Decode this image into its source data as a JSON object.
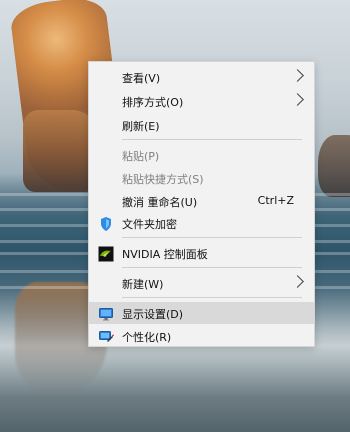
{
  "menu": {
    "items": [
      {
        "label": "查看(V)",
        "has_submenu": true,
        "disabled": false,
        "shortcut": ""
      },
      {
        "label": "排序方式(O)",
        "has_submenu": true,
        "disabled": false,
        "shortcut": ""
      },
      {
        "label": "刷新(E)",
        "has_submenu": false,
        "disabled": false,
        "shortcut": ""
      },
      {
        "label": "粘贴(P)",
        "has_submenu": false,
        "disabled": true,
        "shortcut": ""
      },
      {
        "label": "粘贴快捷方式(S)",
        "has_submenu": false,
        "disabled": true,
        "shortcut": ""
      },
      {
        "label": "撤消 重命名(U)",
        "has_submenu": false,
        "disabled": false,
        "shortcut": "Ctrl+Z"
      },
      {
        "label": "文件夹加密",
        "has_submenu": false,
        "disabled": false,
        "shortcut": "",
        "icon": "shield-icon"
      },
      {
        "label": "NVIDIA 控制面板",
        "has_submenu": false,
        "disabled": false,
        "shortcut": "",
        "icon": "nvidia-icon"
      },
      {
        "label": "新建(W)",
        "has_submenu": true,
        "disabled": false,
        "shortcut": ""
      },
      {
        "label": "显示设置(D)",
        "has_submenu": false,
        "disabled": false,
        "shortcut": "",
        "icon": "monitor-icon",
        "highlighted": true
      },
      {
        "label": "个性化(R)",
        "has_submenu": false,
        "disabled": false,
        "shortcut": "",
        "icon": "personalize-icon"
      }
    ]
  },
  "colors": {
    "menu_background": "#f2f2f2",
    "highlight_background": "#d9d9d9",
    "disabled_text": "#7f7f7f"
  }
}
